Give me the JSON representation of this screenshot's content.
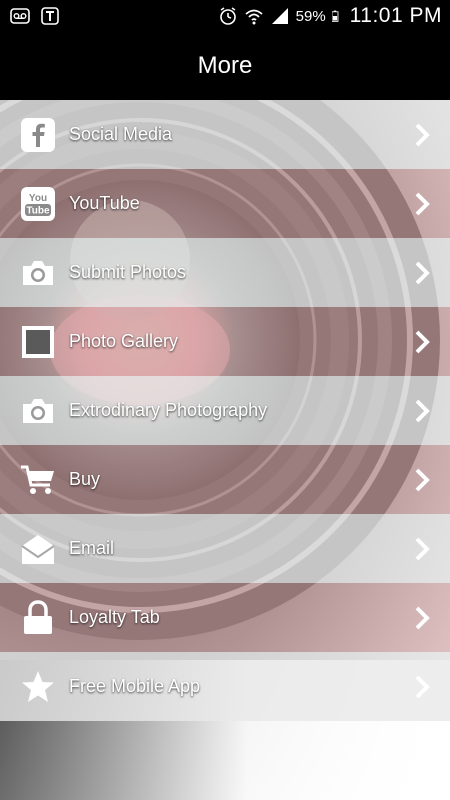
{
  "status_bar": {
    "battery_pct": "59%",
    "time": "11:01 PM"
  },
  "header": {
    "title": "More"
  },
  "menu": {
    "items": [
      {
        "label": "Social Media",
        "icon": "facebook-icon"
      },
      {
        "label": "YouTube",
        "icon": "youtube-icon",
        "icon_text_top": "You",
        "icon_text_bottom": "Tube"
      },
      {
        "label": "Submit Photos",
        "icon": "camera-icon"
      },
      {
        "label": "Photo Gallery",
        "icon": "picture-frame-icon"
      },
      {
        "label": "Extrodinary Photography",
        "icon": "camera-icon"
      },
      {
        "label": "Buy",
        "icon": "cart-icon"
      },
      {
        "label": "Email",
        "icon": "envelope-icon"
      },
      {
        "label": "Loyalty Tab",
        "icon": "lock-icon"
      },
      {
        "label": "Free Mobile App",
        "icon": "star-icon"
      }
    ]
  },
  "colors": {
    "bar_background": "#000000",
    "row_light": "#e8e8e8",
    "row_pink": "#e2aaac",
    "text": "#ffffff"
  }
}
